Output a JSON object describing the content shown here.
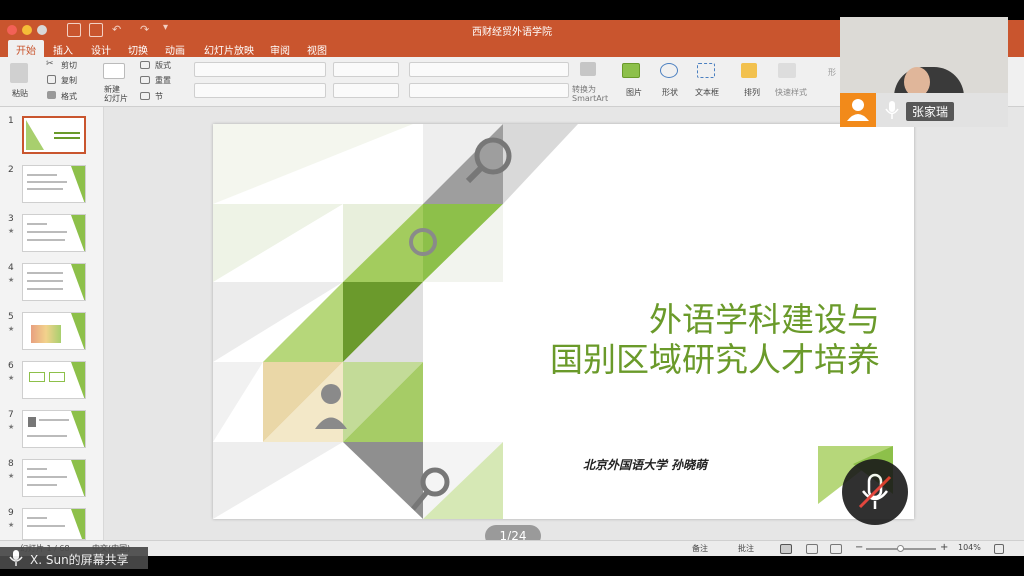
{
  "window": {
    "title": "西财经贸外语学院"
  },
  "ribbon_tabs": [
    "开始",
    "插入",
    "设计",
    "切换",
    "动画",
    "幻灯片放映",
    "审阅",
    "视图"
  ],
  "ribbon": {
    "paste": "粘贴",
    "cut": "剪切",
    "copy": "复制",
    "format": "格式",
    "new_slide": "新建\n幻灯片",
    "layout": "版式",
    "reset": "重置",
    "section": "节",
    "convert_smartart": "转换为\nSmartArt",
    "picture": "图片",
    "shape": "形状",
    "textbox": "文本框",
    "arrange": "排列",
    "quick_styles": "快速样式",
    "shape_fill": "形"
  },
  "thumbnails": [
    {
      "num": "1",
      "star": ""
    },
    {
      "num": "2",
      "star": ""
    },
    {
      "num": "3",
      "star": "★"
    },
    {
      "num": "4",
      "star": "★"
    },
    {
      "num": "5",
      "star": "★"
    },
    {
      "num": "6",
      "star": "★"
    },
    {
      "num": "7",
      "star": "★"
    },
    {
      "num": "8",
      "star": "★"
    },
    {
      "num": "9",
      "star": "★"
    }
  ],
  "slide": {
    "title_line1": "外语学科建设与",
    "title_line2": "国别区域研究人才培养",
    "author": "北京外国语大学  孙晓萌"
  },
  "pager": "1/24",
  "status": {
    "slide_count": "幻灯片 1 / 68",
    "language": "中文(中国)",
    "notes": "备注",
    "comments": "批注",
    "zoom": "104%"
  },
  "share": {
    "label": "X. Sun的屏幕共享"
  },
  "video": {
    "name": "张家瑞"
  },
  "colors": {
    "accent": "#c9552e",
    "slide_green": "#6a9a2a",
    "light_green": "#8dc04a"
  }
}
